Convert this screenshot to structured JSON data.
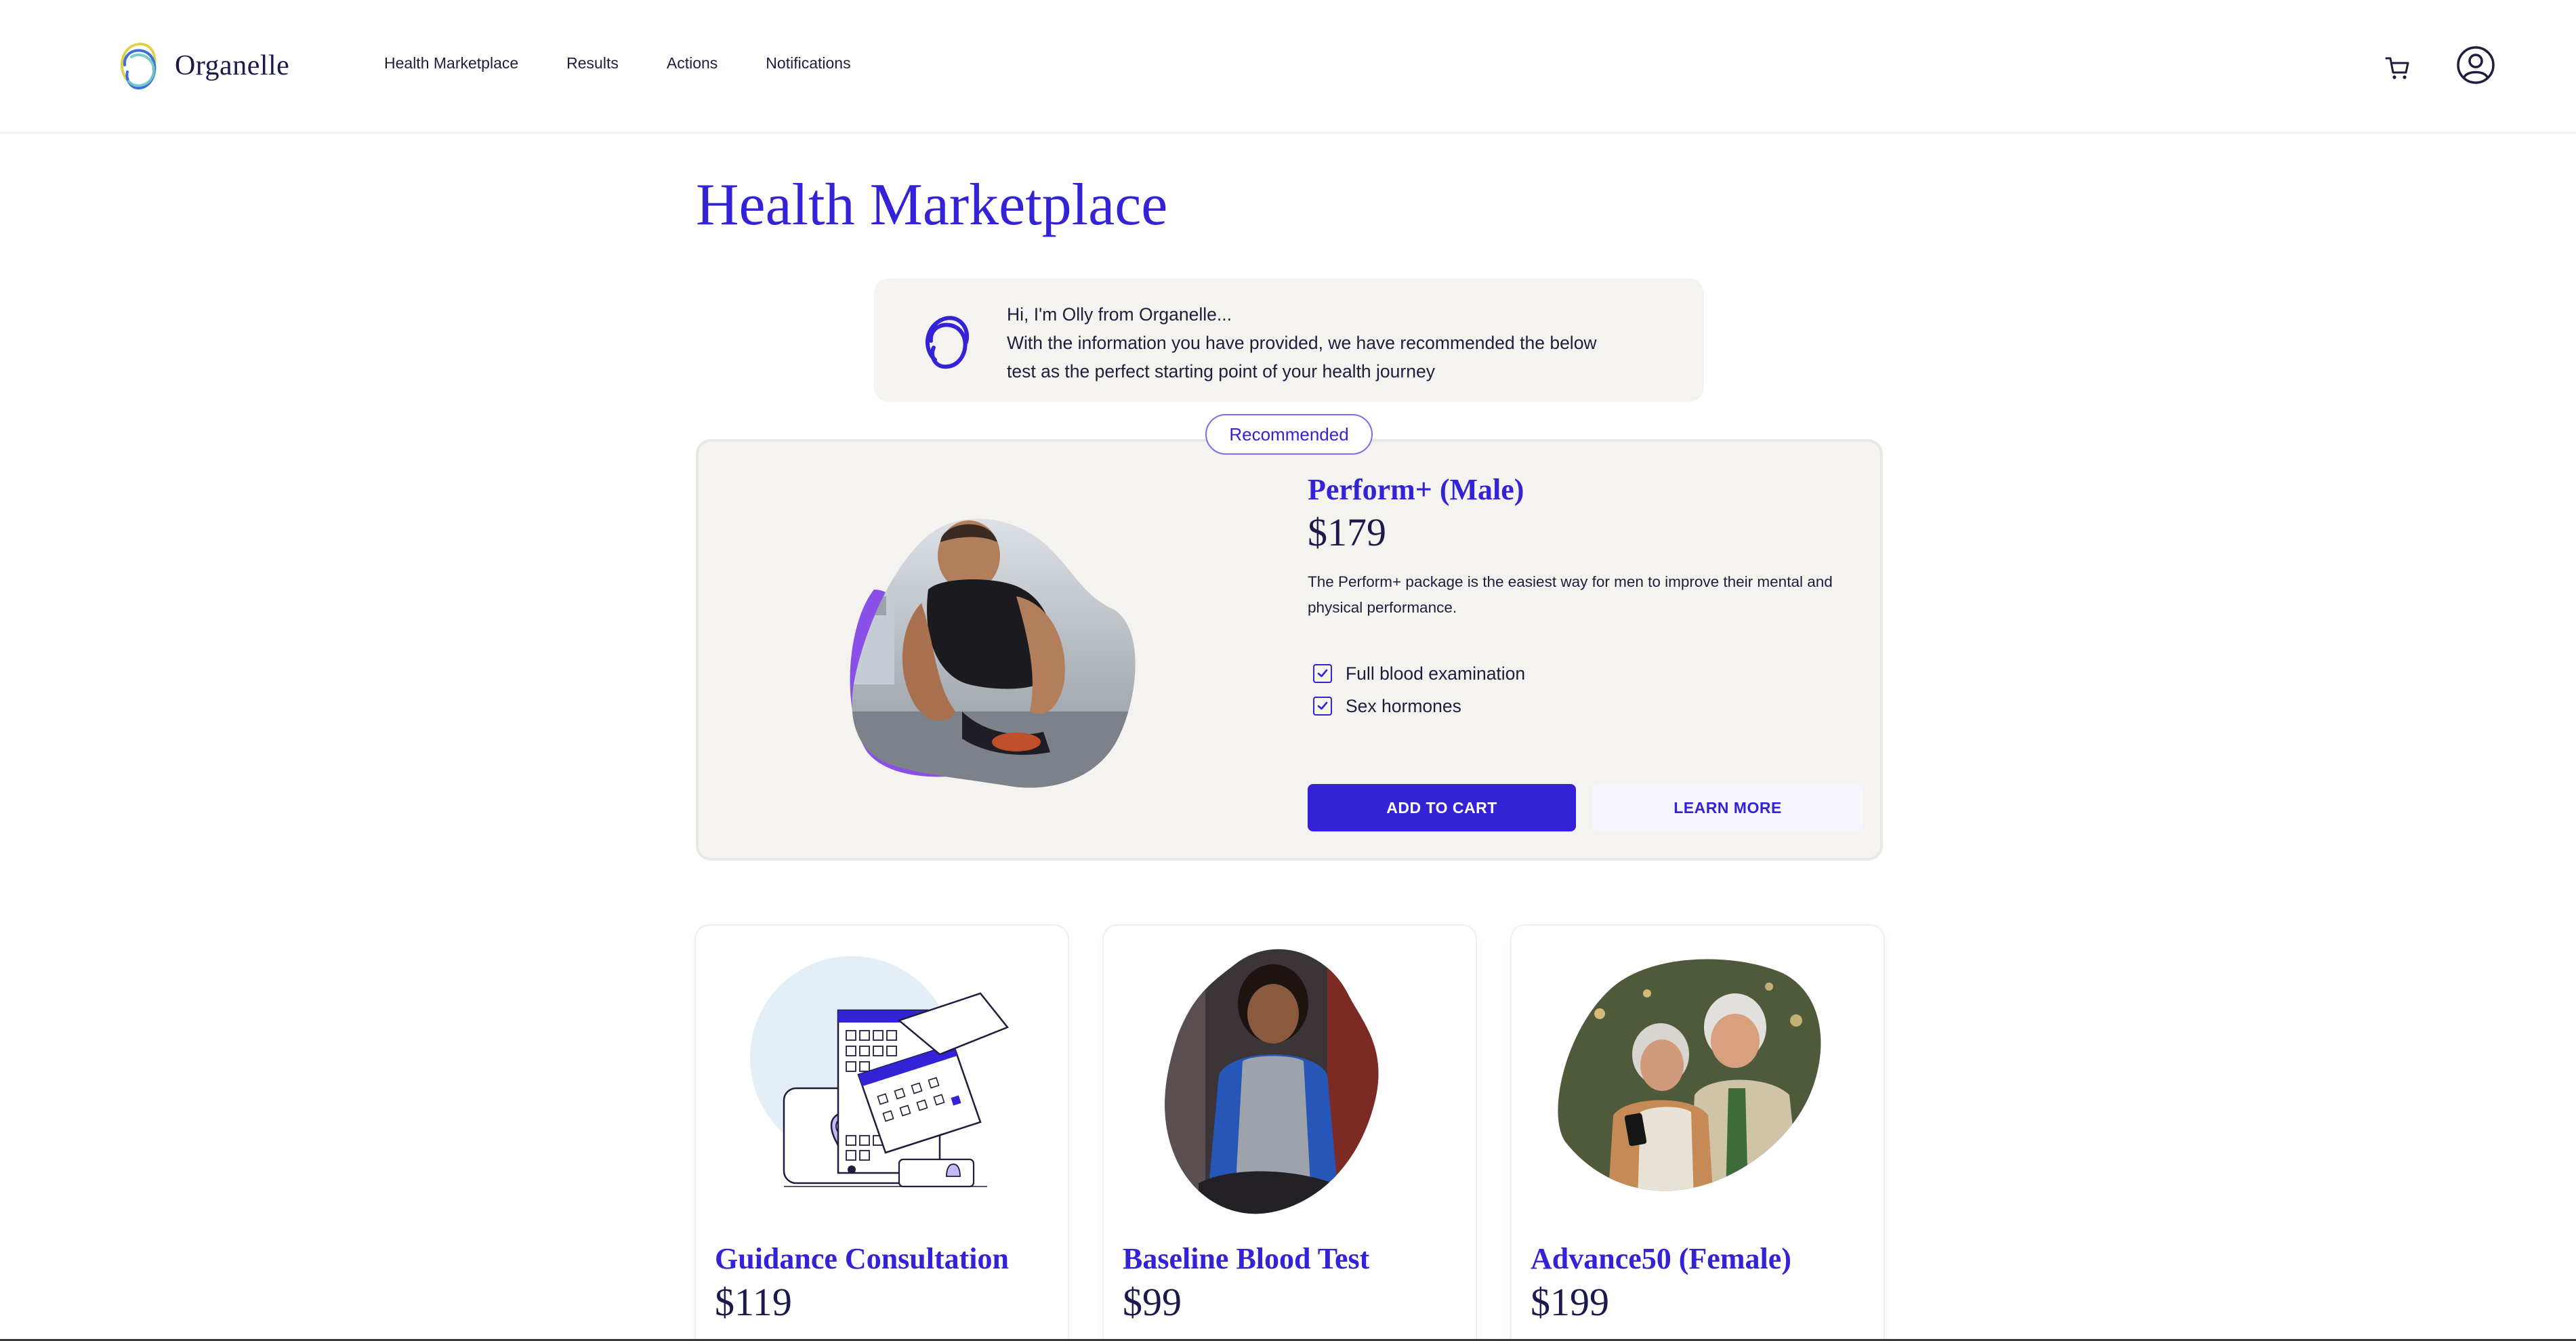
{
  "brand": {
    "name": "Organelle"
  },
  "nav": {
    "items": [
      {
        "label": "Health Marketplace"
      },
      {
        "label": "Results"
      },
      {
        "label": "Actions"
      },
      {
        "label": "Notifications"
      }
    ]
  },
  "header_icons": {
    "cart": "cart-icon",
    "account": "user-account-icon"
  },
  "page": {
    "title": "Health Marketplace"
  },
  "assistant": {
    "lines": [
      "Hi, I'm Olly from Organelle...",
      "With the information you have provided, we have recommended the below",
      "test as the perfect starting point of your health journey"
    ]
  },
  "featured": {
    "badge": "Recommended",
    "title": "Perform+ (Male)",
    "price": "$179",
    "description": "The Perform+ package is the easiest way for men to improve their mental and physical performance.",
    "features": [
      "Full blood examination",
      "Sex hormones"
    ],
    "add_to_cart": "ADD TO CART",
    "learn_more": "LEARN MORE"
  },
  "products": [
    {
      "title": "Guidance Consultation",
      "price": "$119"
    },
    {
      "title": "Baseline Blood Test",
      "price": "$99"
    },
    {
      "title": "Advance50 (Female)",
      "price": "$199"
    }
  ],
  "colors": {
    "accent": "#3423d6",
    "surface": "#f4f3ef",
    "text": "#1f1d3d",
    "accent_light": "#8a6cf2"
  }
}
